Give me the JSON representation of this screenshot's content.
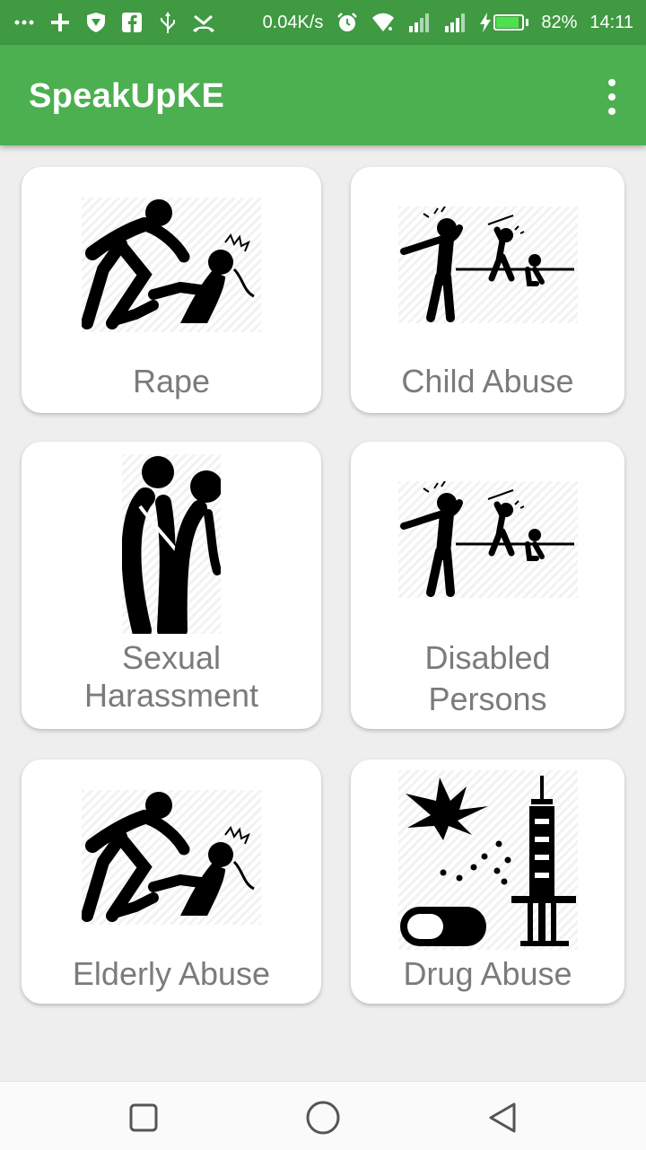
{
  "status_bar": {
    "left_icons": [
      "more-dots-icon",
      "plus-icon",
      "shield-icon",
      "facebook-icon",
      "usb-icon",
      "missed-call-icon"
    ],
    "network_speed": "0.04K/s",
    "right_icons": [
      "alarm-icon",
      "wifi-icon",
      "signal-icon",
      "signal-icon",
      "charging-icon"
    ],
    "battery_percent": "82%",
    "battery_level": 0.82,
    "time": "14:11"
  },
  "app_bar": {
    "title": "SpeakUpKE",
    "overflow_icon": "more-vert-icon"
  },
  "categories": [
    {
      "label": "Rape",
      "icon": "assault-icon"
    },
    {
      "label": "Child Abuse",
      "icon": "child-abuse-icon"
    },
    {
      "label_lines": [
        "Sexual",
        "Harassment"
      ],
      "icon": "harassment-icon"
    },
    {
      "label_lines": [
        "Disabled",
        "Persons"
      ],
      "icon": "child-abuse-icon"
    },
    {
      "label": "Elderly Abuse",
      "icon": "assault-icon"
    },
    {
      "label": "Drug Abuse",
      "icon": "drugs-icon"
    }
  ],
  "nav_bar": {
    "buttons": [
      "recents-icon",
      "home-icon",
      "back-icon"
    ]
  },
  "colors": {
    "status_bar": "#3f9a42",
    "app_bar": "#4caf50",
    "background": "#eeeeee",
    "label_text": "#7b7b7b"
  }
}
